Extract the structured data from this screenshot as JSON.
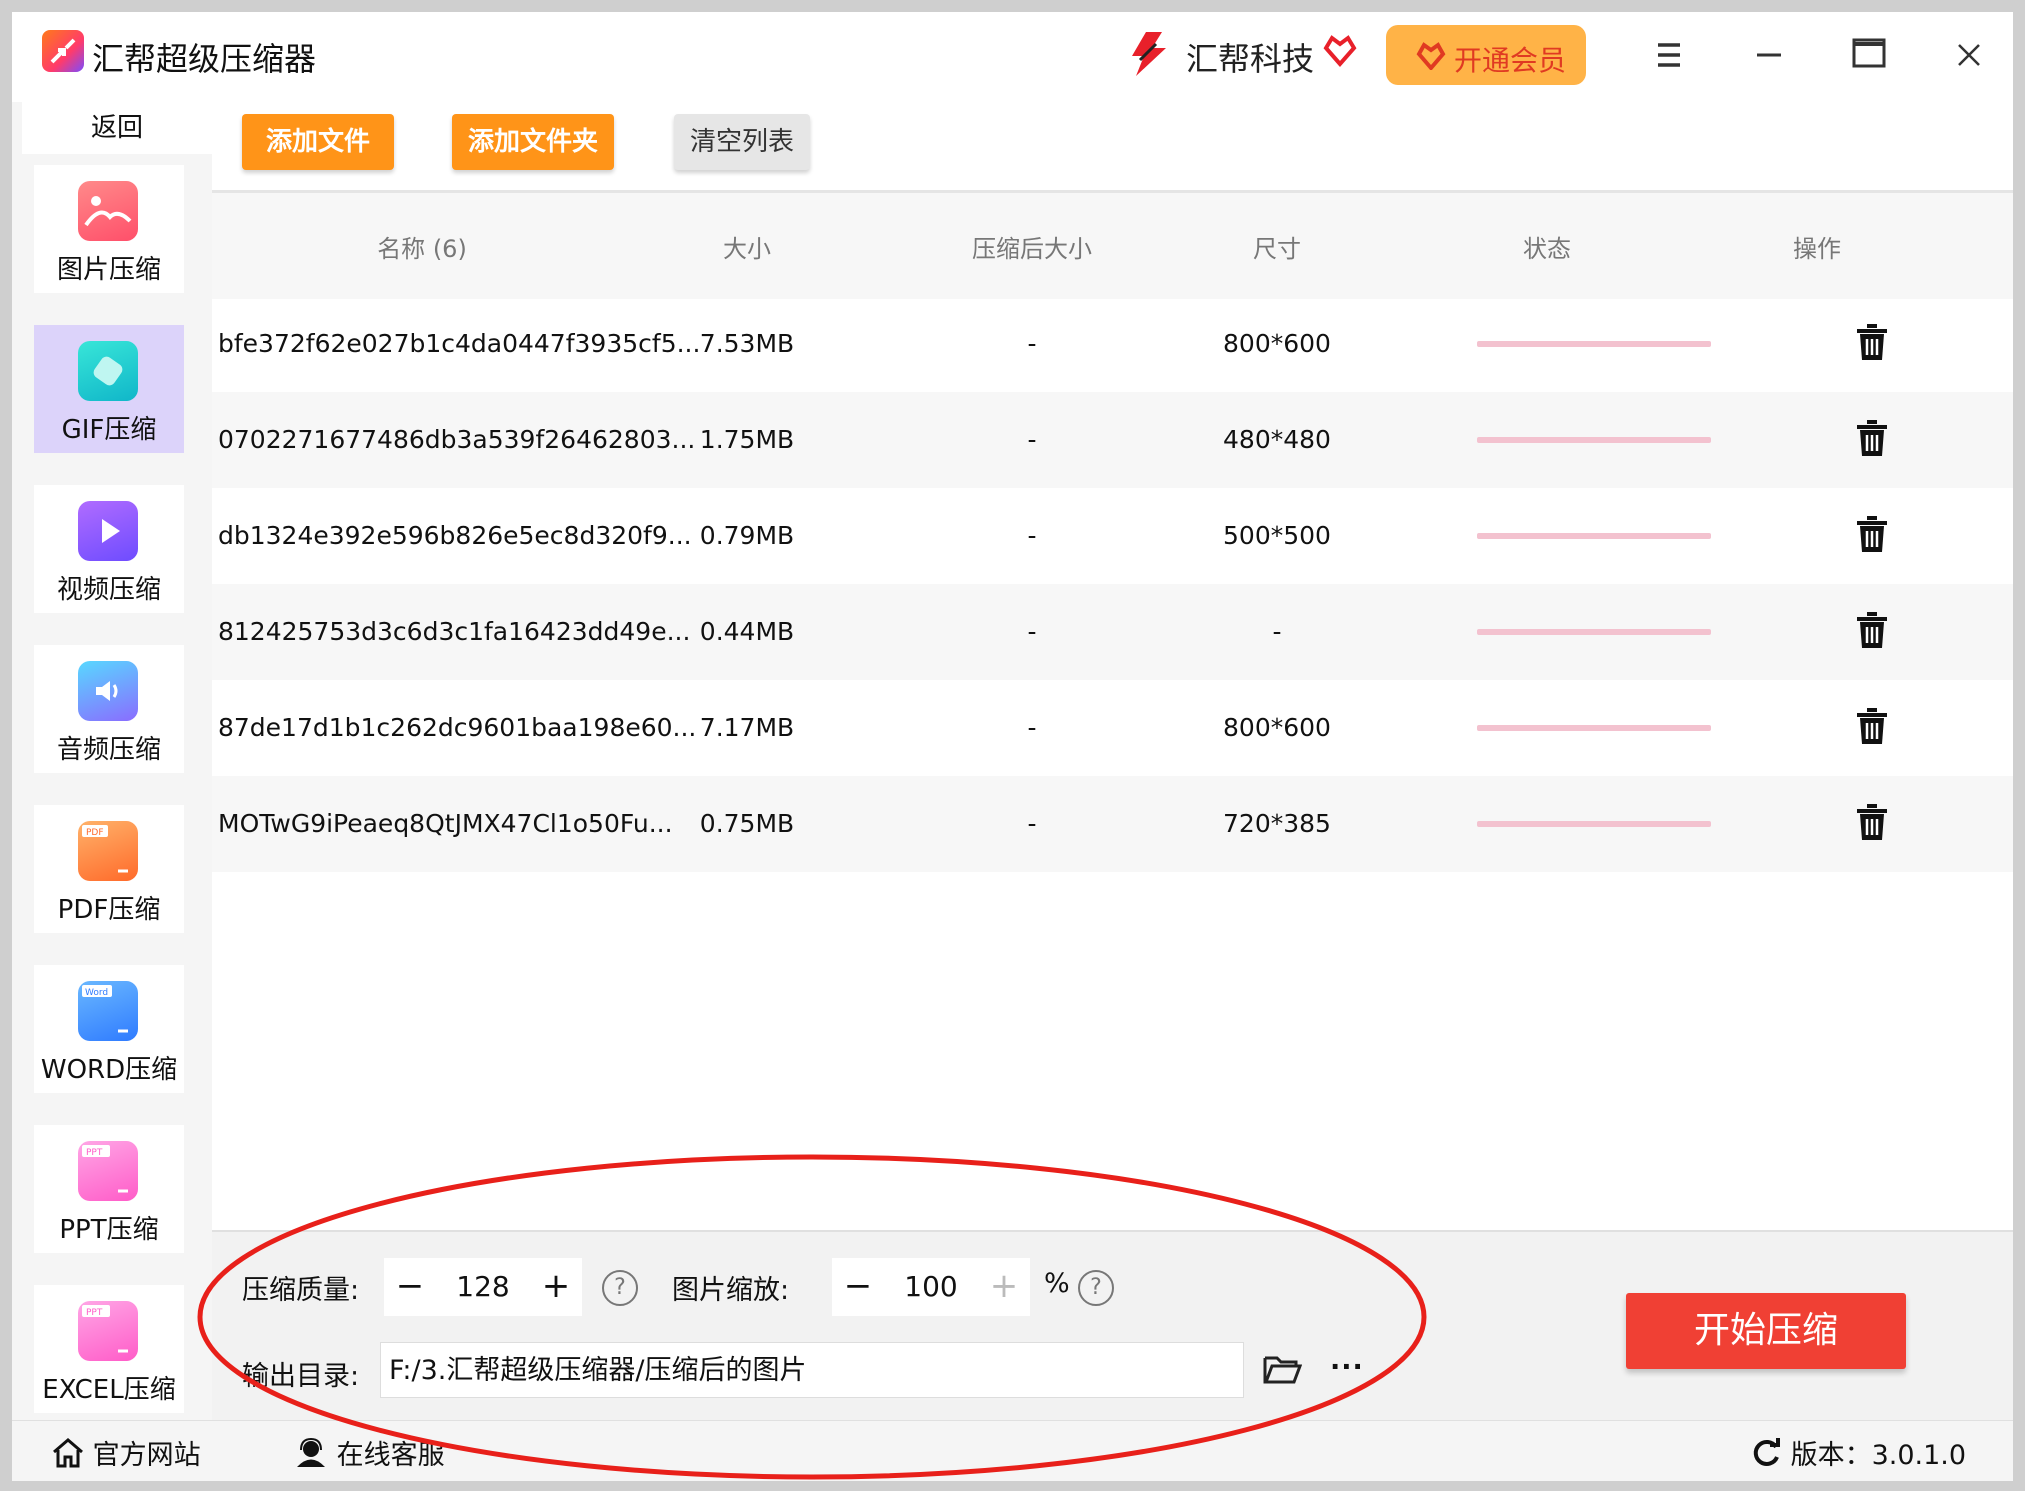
{
  "app": {
    "title": "汇帮超级压缩器",
    "brand": "汇帮科技",
    "vip_label": "开通会员"
  },
  "sidebar": {
    "back_label": "返回",
    "items": [
      {
        "label": "图片压缩",
        "icon": "image-icon",
        "color": "#ff6b6b"
      },
      {
        "label": "GIF压缩",
        "icon": "gif-icon",
        "color": "#1fd1c9"
      },
      {
        "label": "视频压缩",
        "icon": "video-icon",
        "color": "#8a5cff"
      },
      {
        "label": "音频压缩",
        "icon": "audio-icon",
        "color": "#4aa8ff"
      },
      {
        "label": "PDF压缩",
        "icon": "pdf-icon",
        "color": "#ff8a3d"
      },
      {
        "label": "WORD压缩",
        "icon": "word-icon",
        "color": "#3d8bff"
      },
      {
        "label": "PPT压缩",
        "icon": "ppt-icon",
        "color": "#ff6fd0"
      },
      {
        "label": "EXCEL压缩",
        "icon": "excel-icon",
        "color": "#ff6fd0"
      }
    ],
    "active_index": 1
  },
  "toolbar": {
    "add_file": "添加文件",
    "add_folder": "添加文件夹",
    "clear_list": "清空列表"
  },
  "table": {
    "headers": [
      "名称 (6)",
      "大小",
      "压缩后大小",
      "尺寸",
      "状态",
      "操作"
    ],
    "rows": [
      {
        "name": "bfe372f62e027b1c4da0447f3935cf5...",
        "size": "7.53MB",
        "compressed": "-",
        "dims": "800*600"
      },
      {
        "name": "0702271677486db3a539f26462803...",
        "size": "1.75MB",
        "compressed": "-",
        "dims": "480*480"
      },
      {
        "name": "db1324e392e596b826e5ec8d320f9...",
        "size": "0.79MB",
        "compressed": "-",
        "dims": "500*500"
      },
      {
        "name": "812425753d3c6d3c1fa16423dd49e...",
        "size": "0.44MB",
        "compressed": "-",
        "dims": "-"
      },
      {
        "name": "87de17d1b1c262dc9601baa198e60...",
        "size": "7.17MB",
        "compressed": "-",
        "dims": "800*600"
      },
      {
        "name": "MOTwG9iPeaeq8QtJMX47Cl1o50Fu...",
        "size": "0.75MB",
        "compressed": "-",
        "dims": "720*385"
      }
    ]
  },
  "settings": {
    "quality_label": "压缩质量:",
    "quality_value": "128",
    "minus": "−",
    "plus": "+",
    "scale_label": "图片缩放:",
    "scale_value": "100",
    "percent": "%",
    "help": "?",
    "output_label": "输出目录:",
    "output_path": "F:/3.汇帮超级压缩器/压缩后的图片",
    "more": "···",
    "start_button": "开始压缩"
  },
  "footer": {
    "website": "官方网站",
    "support": "在线客服",
    "version": "版本：3.0.1.0"
  },
  "colors": {
    "accent_orange": "#ff9418",
    "start_red": "#f04034",
    "active_side": "#dcd3fa",
    "status_bar": "#f3c2cf",
    "annotation_red": "#e8201a"
  }
}
